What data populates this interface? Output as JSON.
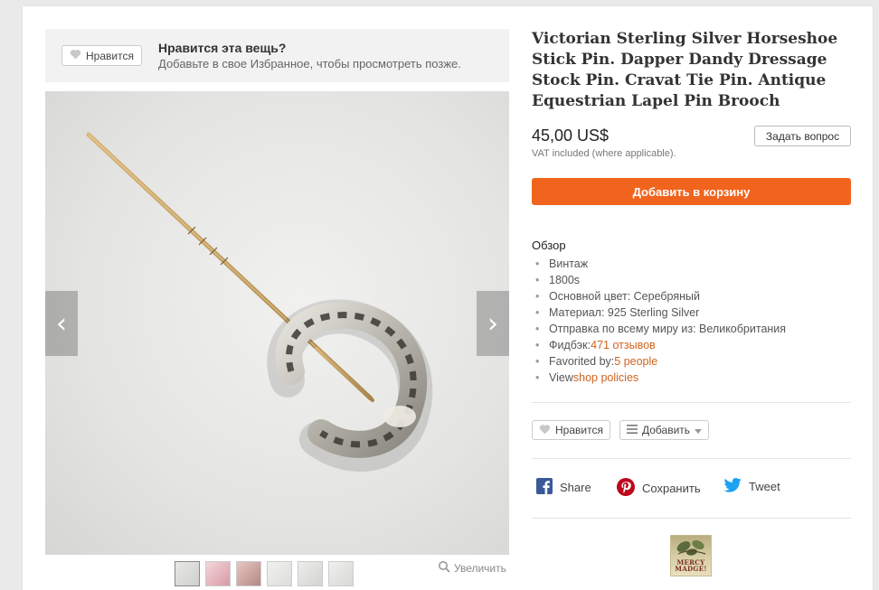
{
  "favorite_prompt": {
    "button_label": "Нравится",
    "title": "Нравится эта вещь?",
    "subtitle": "Добавьте в свое Избранное, чтобы просмотреть позже."
  },
  "gallery": {
    "prev_icon": "‹",
    "next_icon": "›",
    "zoom_label": "Увеличить",
    "thumbnail_count": 6
  },
  "listing": {
    "title": "Victorian Sterling Silver Horseshoe Stick Pin. Dapper Dandy Dressage Stock Pin. Cravat Tie Pin. Antique Equestrian Lapel Pin Brooch",
    "price": "45,00 US$",
    "vat_note": "VAT included (where applicable).",
    "ask_button": "Задать вопрос",
    "cart_button": "Добавить в корзину"
  },
  "overview": {
    "heading": "Обзор",
    "items": [
      {
        "text": "Винтаж",
        "link": ""
      },
      {
        "text": "1800s",
        "link": ""
      },
      {
        "text": "Основной цвет: Серебряный",
        "link": ""
      },
      {
        "text": "Материал: 925 Sterling Silver",
        "link": ""
      },
      {
        "text": "Отправка по всему миру из: Великобритания",
        "link": ""
      },
      {
        "text": "Фидбэк: ",
        "link": "471 отзывов"
      },
      {
        "text": "Favorited by: ",
        "link": "5 people"
      },
      {
        "text": "View ",
        "link": "shop policies"
      }
    ]
  },
  "actions": {
    "like_label": "Нравится",
    "add_label": "Добавить"
  },
  "share": {
    "facebook": "Share",
    "pinterest": "Сохранить",
    "twitter": "Tweet"
  },
  "shop": {
    "logo_text_line1": "MERCY",
    "logo_text_line2": "MADGE!"
  },
  "colors": {
    "accent": "#f1641e",
    "link": "#d0631f",
    "facebook": "#3b5998",
    "pinterest": "#bd081c",
    "twitter": "#1da1f2"
  }
}
